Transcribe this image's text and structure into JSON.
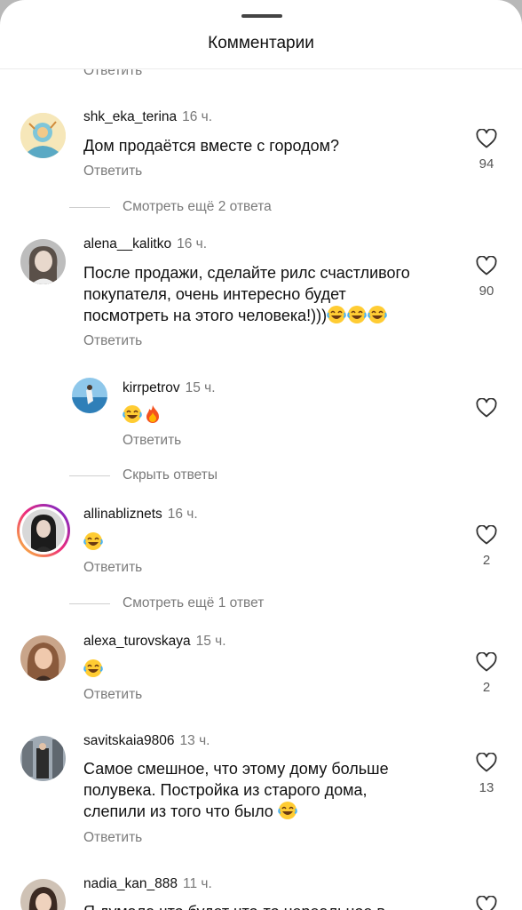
{
  "sheet": {
    "title": "Комментарии"
  },
  "top_partial": {
    "reply_label": "Ответить"
  },
  "comments": [
    {
      "username": "shk_eka_terina",
      "time": "16 ч.",
      "text": "Дом продаётся вместе с городом?",
      "reply_label": "Ответить",
      "likes": "94"
    },
    {
      "username": "alena__kalitko",
      "time": "16 ч.",
      "text_lines": [
        "После продажи, сделайте рилс счастливого",
        "покупателя, очень интересно будет",
        "посмотреть на этого человека!)))"
      ],
      "reply_label": "Ответить",
      "likes": "90"
    },
    {
      "username": "allinabliznets",
      "time": "16 ч.",
      "reply_label": "Ответить",
      "likes": "2"
    },
    {
      "username": "alexa_turovskaya",
      "time": "15 ч.",
      "reply_label": "Ответить",
      "likes": "2"
    },
    {
      "username": "savitskaia9806",
      "time": "13 ч.",
      "text_lines": [
        "Самое смешное, что этому дому больше",
        "полувека. Постройка из старого дома,",
        "слепили из того что было"
      ],
      "reply_label": "Ответить",
      "likes": "13"
    },
    {
      "username": "nadia_kan_888",
      "time": "11 ч.",
      "text_lines": [
        "Я думала что будет что-то нереальное в"
      ]
    }
  ],
  "reply_thread": {
    "username": "kirrpetrov",
    "time": "15 ч.",
    "reply_label": "Ответить"
  },
  "thread_links": {
    "more_2": "Смотреть ещё 2 ответа",
    "hide": "Скрыть ответы",
    "more_1": "Смотреть ещё 1 ответ"
  },
  "icons": [
    "heart-icon",
    "laughing-emoji-icon",
    "fire-emoji-icon"
  ],
  "colors": {
    "story_ring_start": "#f9ce34",
    "story_ring_mid": "#ee2a7b",
    "story_ring_end": "#6228d7",
    "text": "#111111",
    "muted": "#7a7a7a"
  }
}
